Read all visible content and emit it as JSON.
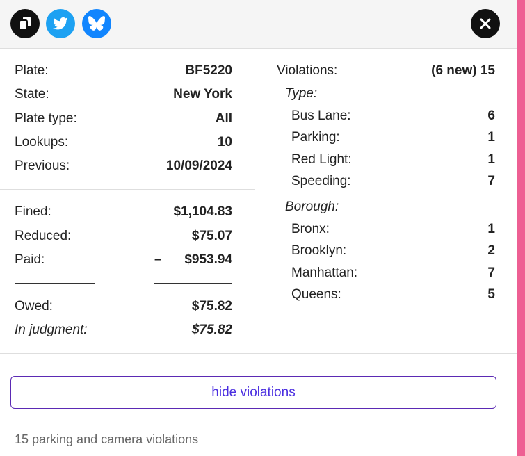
{
  "toolbar": {
    "copy_icon": "copy-icon",
    "twitter_icon": "twitter-icon",
    "bluesky_icon": "bluesky-icon",
    "close_icon": "close-icon"
  },
  "vehicle": {
    "plate_label": "Plate:",
    "plate": "BF5220",
    "state_label": "State:",
    "state": "New York",
    "plate_type_label": "Plate type:",
    "plate_type": "All",
    "lookups_label": "Lookups:",
    "lookups": "10",
    "previous_label": "Previous:",
    "previous": "10/09/2024"
  },
  "fines": {
    "fined_label": "Fined:",
    "fined": "$1,104.83",
    "reduced_label": "Reduced:",
    "reduced": "$75.07",
    "paid_label": "Paid:",
    "paid_prefix": "–",
    "paid": "$953.94",
    "owed_label": "Owed:",
    "owed": "$75.82",
    "judgment_label": "In judgment:",
    "judgment": "$75.82"
  },
  "violations": {
    "label": "Violations:",
    "total": "(6 new) 15",
    "type_heading": "Type:",
    "types": [
      {
        "label": "Bus Lane:",
        "count": "6"
      },
      {
        "label": "Parking:",
        "count": "1"
      },
      {
        "label": "Red Light:",
        "count": "1"
      },
      {
        "label": "Speeding:",
        "count": "7"
      }
    ],
    "borough_heading": "Borough:",
    "boroughs": [
      {
        "label": "Bronx:",
        "count": "1"
      },
      {
        "label": "Brooklyn:",
        "count": "2"
      },
      {
        "label": "Manhattan:",
        "count": "7"
      },
      {
        "label": "Queens:",
        "count": "5"
      }
    ]
  },
  "actions": {
    "hide_violations": "hide violations"
  },
  "footer": {
    "summary": "15 parking and camera violations"
  },
  "colors": {
    "accent_bar": "#ee5f93",
    "twitter": "#1da1f2",
    "bluesky": "#1185fe",
    "button_text": "#4a2ee0"
  }
}
